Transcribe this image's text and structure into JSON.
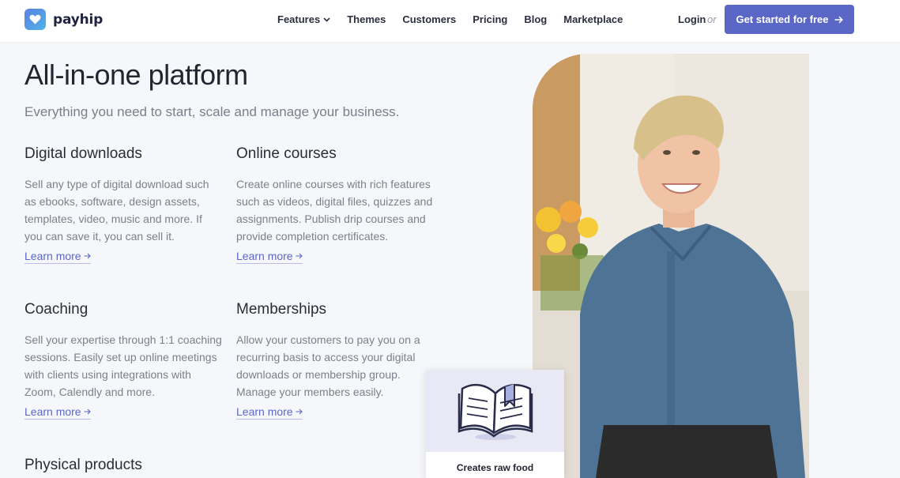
{
  "header": {
    "logo_text": "payhip",
    "nav": [
      {
        "label": "Features",
        "has_dropdown": true
      },
      {
        "label": "Themes"
      },
      {
        "label": "Customers"
      },
      {
        "label": "Pricing"
      },
      {
        "label": "Blog"
      },
      {
        "label": "Marketplace"
      }
    ],
    "login": "Login",
    "or": "or",
    "cta": "Get started for free"
  },
  "hero": {
    "title": "All-in-one platform",
    "subtitle": "Everything you need to start, scale and manage your business."
  },
  "features": [
    {
      "title": "Digital downloads",
      "text": "Sell any type of digital download such as ebooks, software, design assets, templates, video, music and more. If you can save it, you can sell it.",
      "link": "Learn more"
    },
    {
      "title": "Online courses",
      "text": "Create online courses with rich features such as videos, digital files, quizzes and assignments. Publish drip courses and provide completion certificates.",
      "link": "Learn more"
    },
    {
      "title": "Coaching",
      "text": "Sell your expertise through 1:1 coaching sessions. Easily set up online meetings with clients using integrations with Zoom, Calendly and more.",
      "link": "Learn more"
    },
    {
      "title": "Memberships",
      "text": "Allow your customers to pay you on a recurring basis to access your digital downloads or membership group. Manage your members easily.",
      "link": "Learn more"
    },
    {
      "title": "Physical products"
    }
  ],
  "card": {
    "caption": "Creates raw food"
  },
  "colors": {
    "accent": "#5b67c7",
    "link_underline": "#b8bde6",
    "background": "#f5f7fa"
  }
}
